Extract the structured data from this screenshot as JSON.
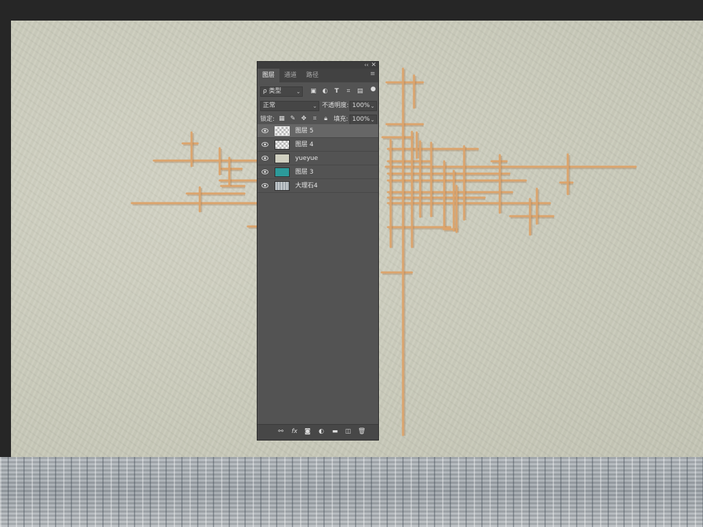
{
  "layers_panel": {
    "collapse_icon": "double-chevron-icon",
    "close_icon": "close-icon",
    "tabs": [
      {
        "label": "图层",
        "active": true
      },
      {
        "label": "通道",
        "active": false
      },
      {
        "label": "路径",
        "active": false
      }
    ],
    "menu_icon": "panel-menu-icon",
    "filter": {
      "label": "ρ 类型"
    },
    "filter_icons": [
      "image-filter-icon",
      "adjustment-filter-icon",
      "type-filter-icon",
      "shape-filter-icon",
      "smart-object-filter-icon",
      "filter-toggle-icon"
    ],
    "blend_mode": "正常",
    "opacity_label": "不透明度:",
    "opacity_value": "100%",
    "lock_label": "锁定:",
    "lock_icons": [
      "lock-transparent-icon",
      "lock-paint-icon",
      "lock-move-icon",
      "lock-artboard-icon",
      "lock-all-icon"
    ],
    "fill_label": "填充:",
    "fill_value": "100%",
    "layers": [
      {
        "name": "图层 5",
        "thumb": "transparent",
        "selected": true,
        "visible": true
      },
      {
        "name": "图层 4",
        "thumb": "transparent",
        "selected": false,
        "visible": true
      },
      {
        "name": "yueyue",
        "thumb": "beige",
        "selected": false,
        "visible": true
      },
      {
        "name": "图层 3",
        "thumb": "teal",
        "selected": false,
        "visible": true
      },
      {
        "name": "大理石4",
        "thumb": "marble",
        "selected": false,
        "visible": true
      }
    ],
    "bottom_icons": [
      "link-layers-icon",
      "fx-icon",
      "add-mask-icon",
      "adjustment-layer-icon",
      "new-group-icon",
      "new-layer-icon",
      "delete-icon"
    ],
    "fx_label": "fx"
  },
  "colors": {
    "rod": "#dca46c",
    "rod_shadow": "#a07a55",
    "wall": "#c9cabb",
    "panel": "#535353"
  }
}
